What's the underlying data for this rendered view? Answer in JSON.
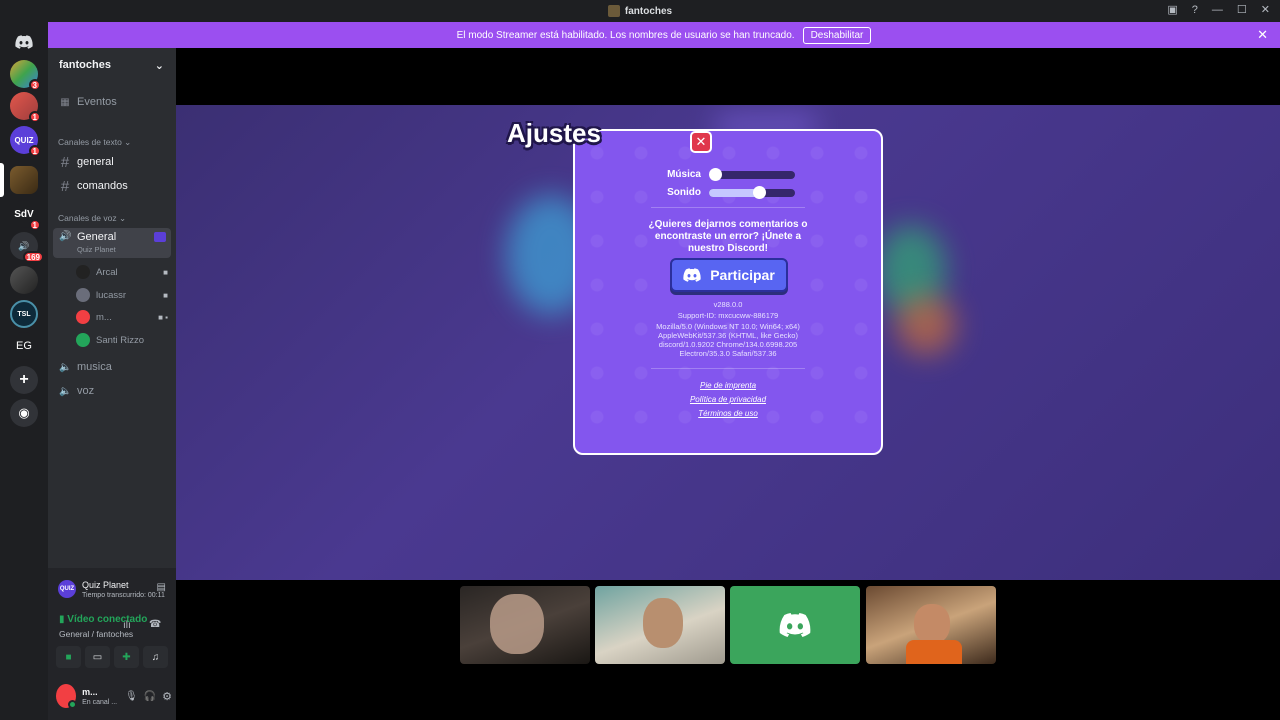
{
  "window": {
    "title": "fantoches"
  },
  "banner": {
    "text": "El modo Streamer está habilitado. Los nombres de usuario se han truncado.",
    "button": "Deshabilitar"
  },
  "guilds": {
    "badges": [
      "3",
      "1",
      "1",
      "1",
      "169"
    ],
    "labels": {
      "quiz": "QUIZ",
      "sdv": "SdV",
      "tsl": "TSL",
      "eg": "EG"
    }
  },
  "sidebar": {
    "server_name": "fantoches",
    "events": "Eventos",
    "text_category": "Canales de texto",
    "text_channels": [
      "general",
      "comandos"
    ],
    "voice_category": "Canales de voz",
    "voice_general": {
      "name": "General",
      "activity": "Quiz Planet"
    },
    "voice_users": [
      "Arcal",
      "lucassr",
      "m...",
      "Santi Rizzo"
    ],
    "voice_channels": [
      "musica",
      "voz"
    ]
  },
  "voice_panel": {
    "activity_name": "Quiz Planet",
    "elapsed": "Tiempo transcurrido: 00:11",
    "status": "Vídeo conectado",
    "location": "General / fantoches",
    "user_name": "m...",
    "user_status": "En canal ..."
  },
  "dialog": {
    "title": "Ajustes",
    "music_label": "Música",
    "sound_label": "Sonido",
    "music_level": 0.0,
    "sound_level": 0.58,
    "feedback": [
      "¿Quieres dejarnos comentarios o",
      "encontraste un error? ¡Únete a",
      "nuestro Discord!"
    ],
    "join_button": "Participar",
    "version": "v288.0.0",
    "support_id": "Support-ID: mxcucww-886179",
    "user_agent": [
      "Mozilla/5.0 (Windows NT 10.0; Win64; x64)",
      "AppleWebKit/537.36 (KHTML, like Gecko)",
      "discord/1.0.9202 Chrome/134.0.6998.205",
      "Electron/35.3.0 Safari/537.36"
    ],
    "links": [
      "Pie de imprenta",
      "Política de privacidad",
      "Términos de uso"
    ]
  },
  "colors": {
    "banner": "#9b4ff0",
    "dialog": "#8356ee",
    "discord_blurple": "#5865f2",
    "connected_green": "#23a55a",
    "badge_red": "#f23f43"
  }
}
